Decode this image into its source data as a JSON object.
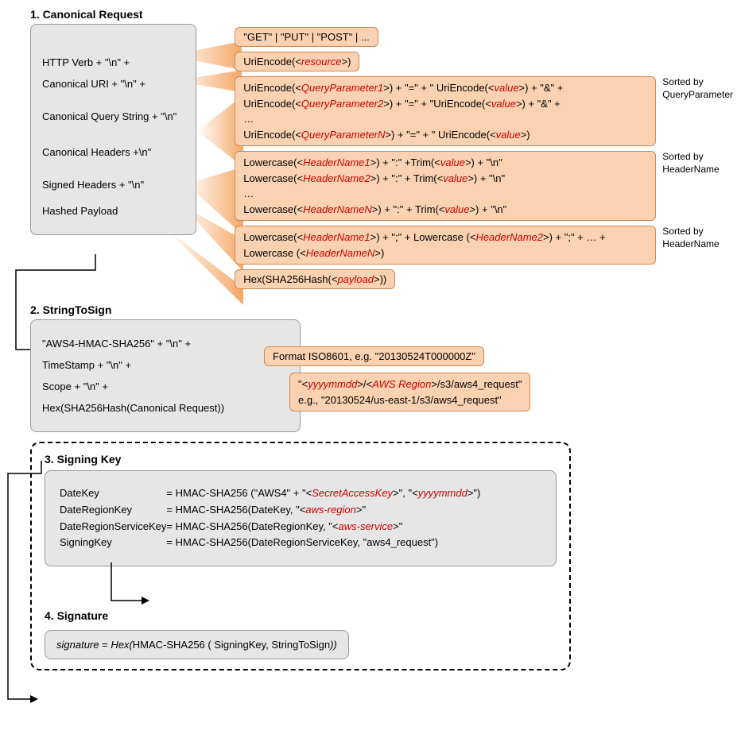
{
  "section1": {
    "title": "1. Canonical Request",
    "items": {
      "httpVerb": "HTTP Verb + \"\\n\" +",
      "canonicalUri": "Canonical URI + \"\\n\" +",
      "canonicalQuery": "Canonical Query String + \"\\n\"",
      "canonicalHeaders": "Canonical Headers +\\n\"",
      "signedHeaders": "Signed Headers + \"\\n\"",
      "hashedPayload": "Hashed Payload"
    },
    "callouts": {
      "verbs": "\"GET\" | \"PUT\" | \"POST\" | ...",
      "uriEncode_pre": "UriEncode(<",
      "uriEncode_res": "resource",
      "uriEncode_post": ">)",
      "qp_line1_a": "UriEncode(<",
      "qp_line1_b": "QueryParameter1",
      "qp_line1_c": ">) + \"=\" + \" UriEncode(<",
      "qp_line1_d": "value",
      "qp_line1_e": ">) + \"&\" +",
      "qp_line2_a": "UriEncode(<",
      "qp_line2_b": "QueryParameter2",
      "qp_line2_c": ">) + \"=\" + \"UriEncode(<",
      "qp_line2_d": "value",
      "qp_line2_e": ">) + \"&\" +",
      "qp_ellipsis": "…",
      "qp_lineN_a": "UriEncode(<",
      "qp_lineN_b": "QueryParameterN",
      "qp_lineN_c": ">) + \"=\" + \" UriEncode(<",
      "qp_lineN_d": "value",
      "qp_lineN_e": ">)",
      "hdr_line1_a": "Lowercase(<",
      "hdr_line1_b": "HeaderName1",
      "hdr_line1_c": ">) + \":\" +Trim(<",
      "hdr_line1_d": "value",
      "hdr_line1_e": ">) + \"\\n\"",
      "hdr_line2_a": "Lowercase(<",
      "hdr_line2_b": "HeaderName2",
      "hdr_line2_c": ">) + \":\" + Trim(<",
      "hdr_line2_d": "value",
      "hdr_line2_e": ">) + \"\\n\"",
      "hdr_ellipsis": "…",
      "hdr_lineN_a": "Lowercase(<",
      "hdr_lineN_b": "HeaderNameN",
      "hdr_lineN_c": ">) + \":\" + Trim(<",
      "hdr_lineN_d": "value",
      "hdr_lineN_e": ">) + \"\\n\"",
      "sh_a": "Lowercase(<",
      "sh_b": "HeaderName1",
      "sh_c": ">) + \";\" + Lowercase (<",
      "sh_d": "HeaderName2",
      "sh_e": ">) + \";\" + … + Lowercase (<",
      "sh_f": "HeaderNameN",
      "sh_g": ">)",
      "hash_a": "Hex(SHA256Hash(<",
      "hash_b": "payload",
      "hash_c": ">))"
    },
    "sortNotes": {
      "qp": "Sorted by\nQueryParameter",
      "hdr": "Sorted by\nHeaderName",
      "sh": "Sorted by\nHeaderName"
    }
  },
  "section2": {
    "title": "2. StringToSign",
    "items": {
      "alg": "\"AWS4-HMAC-SHA256\" + \"\\n\" +",
      "timestamp": "TimeStamp + \"\\n\" +",
      "scope": "Scope + \"\\n\" +",
      "hex": "Hex(SHA256Hash(Canonical Request))"
    },
    "callouts": {
      "iso": "Format ISO8601,  e.g. \"20130524T000000Z\"",
      "scope_a": "\"<",
      "scope_b": "yyyymmdd",
      "scope_c": ">/<",
      "scope_d": "AWS Region",
      "scope_e": ">/s3/aws4_request\"",
      "scope_eg": "e.g., \"20130524/us-east-1/s3/aws4_request\""
    }
  },
  "section3": {
    "title": "3. Signing Key",
    "lines": {
      "l1_key": "DateKey",
      "l1_a": "= HMAC-SHA256 (\"AWS4\" + \"<",
      "l1_b": "SecretAccessKey",
      "l1_c": ">\", \"<",
      "l1_d": "yyyymmdd",
      "l1_e": ">\")",
      "l2_key": "DateRegionKey",
      "l2_a": "= HMAC-SHA256(DateKey, \"<",
      "l2_b": "aws-region",
      "l2_c": ">\"",
      "l3_key": "DateRegionServiceKey",
      "l3_a": "= HMAC-SHA256(DateRegionKey, \"<",
      "l3_b": "aws-service",
      "l3_c": ">\"",
      "l4_key": "SigningKey",
      "l4_a": "= HMAC-SHA256(DateRegionServiceKey, \"aws4_request\")"
    }
  },
  "section4": {
    "title": "4. Signature",
    "sig_a": "signature",
    "sig_b": " =   ",
    "sig_c": "Hex(",
    "sig_d": "HMAC-SHA256 ( SigningKey, StringToSign",
    "sig_e": "))"
  }
}
